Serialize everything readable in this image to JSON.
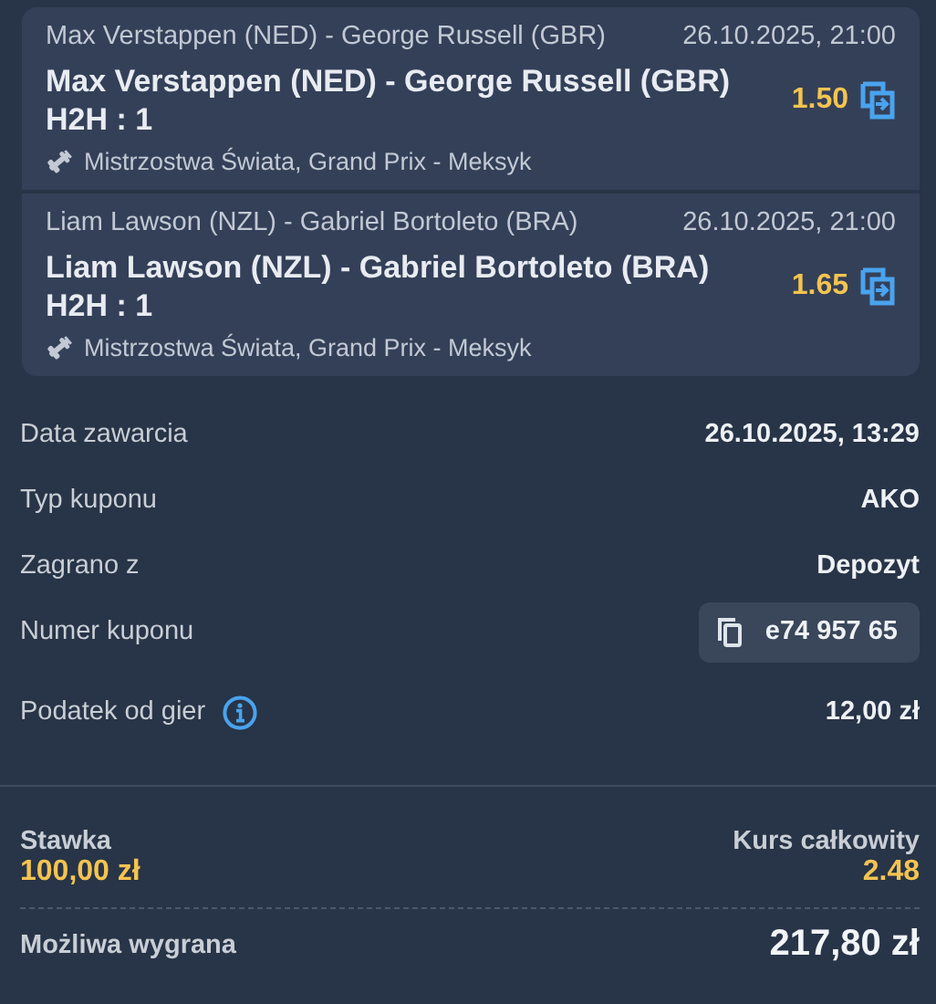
{
  "selections": [
    {
      "event": "Max Verstappen (NED) - George Russell (GBR)",
      "datetime": "26.10.2025, 21:00",
      "market": "Max Verstappen (NED) - George Russell (GBR) H2H : 1",
      "odds": "1.50",
      "competition": "Mistrzostwa Świata, Grand Prix - Meksyk"
    },
    {
      "event": "Liam Lawson (NZL) - Gabriel Bortoleto (BRA)",
      "datetime": "26.10.2025, 21:00",
      "market": "Liam Lawson (NZL) - Gabriel Bortoleto (BRA) H2H : 1",
      "odds": "1.65",
      "competition": "Mistrzostwa Świata, Grand Prix - Meksyk"
    }
  ],
  "details": [
    {
      "kind": "text",
      "label": "Data zawarcia",
      "value": "26.10.2025, 13:29"
    },
    {
      "kind": "text",
      "label": "Typ kuponu",
      "value": "AKO"
    },
    {
      "kind": "text",
      "label": "Zagrano z",
      "value": "Depozyt"
    },
    {
      "kind": "copy",
      "label": "Numer kuponu",
      "value": "e74 957 65"
    },
    {
      "kind": "info",
      "label": "Podatek od gier",
      "value": "12,00 zł"
    }
  ],
  "summary": {
    "stake_label": "Stawka",
    "stake": "100,00 zł",
    "total_odds_label": "Kurs całkowity",
    "total_odds": "2.48",
    "win_label": "Możliwa wygrana",
    "win": "217,80 zł"
  }
}
